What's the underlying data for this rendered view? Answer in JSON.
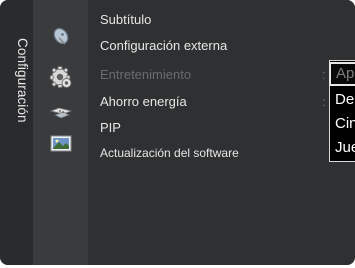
{
  "sidebar": {
    "title": "Configuración",
    "icons": [
      "satellite-dish-icon",
      "gear-icon",
      "remote-control-icon",
      "picture-icon"
    ]
  },
  "menu": {
    "items": [
      {
        "label": "Subtítulo"
      },
      {
        "label": "Configuración externa"
      },
      {
        "label": "Entretenimiento",
        "value": ":"
      },
      {
        "label": "Ahorro energía",
        "value": ":"
      },
      {
        "label": "PIP"
      },
      {
        "label": "Actualización del software"
      }
    ]
  },
  "dropdown": {
    "options": [
      "Apagado",
      "Deportes",
      "Cine",
      "Juegos"
    ],
    "selected_index": 0
  },
  "colors": {
    "background": "#2d2d2f",
    "icon_column": "#3a3b3d",
    "text": "#e6e6e6",
    "disabled_text": "#6b6c6e",
    "dropdown_bg": "#000000",
    "dropdown_border": "#d8d8d8"
  }
}
